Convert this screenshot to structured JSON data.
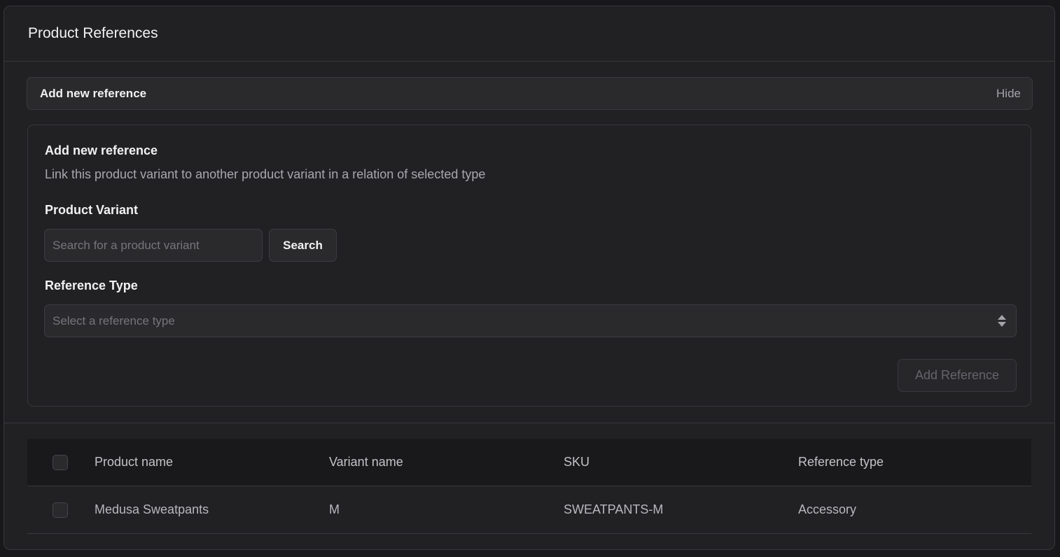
{
  "card": {
    "title": "Product References"
  },
  "collapse": {
    "title": "Add new reference",
    "toggle_label": "Hide"
  },
  "form": {
    "title": "Add new reference",
    "description": "Link this product variant to another product variant in a relation of selected type",
    "variant_label": "Product Variant",
    "search_placeholder": "Search for a product variant",
    "search_button": "Search",
    "type_label": "Reference Type",
    "type_placeholder": "Select a reference type",
    "add_button": "Add Reference"
  },
  "table": {
    "headers": [
      "Product name",
      "Variant name",
      "SKU",
      "Reference type"
    ],
    "rows": [
      {
        "product_name": "Medusa Sweatpants",
        "variant_name": "M",
        "sku": "SWEATPANTS-M",
        "reference_type": "Accessory"
      }
    ]
  },
  "colors": {
    "background": "#18181b",
    "card": "#212124",
    "border": "#38383c",
    "text": "#ededef",
    "muted": "#a8a8ad"
  }
}
